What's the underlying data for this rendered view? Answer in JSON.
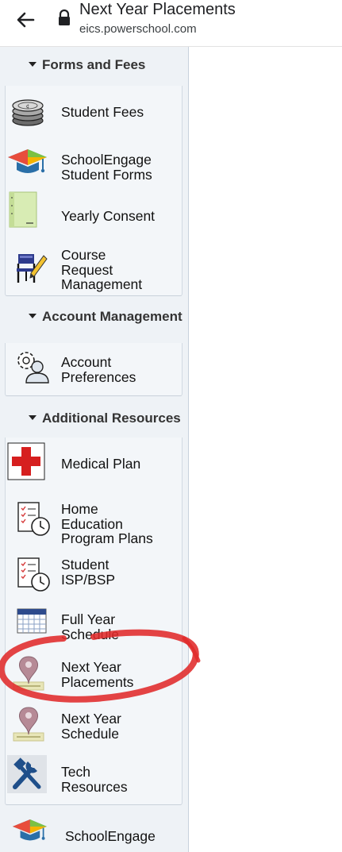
{
  "browser": {
    "title": "Next Year Placements",
    "url": "eics.powerschool.com",
    "back_icon": "back-arrow-icon",
    "lock_icon": "lock-icon"
  },
  "sidebar": {
    "sections": [
      {
        "header": "Forms and Fees",
        "items": [
          {
            "label": "Student Fees",
            "icon": "coins-icon"
          },
          {
            "label": "SchoolEngage\nStudent Forms",
            "icon": "graduation-cap-icon"
          },
          {
            "label": "Yearly Consent",
            "icon": "document-icon"
          },
          {
            "label": "Course\nRequest\nManagement",
            "icon": "chair-pencil-icon"
          }
        ]
      },
      {
        "header": "Account Management",
        "items": [
          {
            "label": "Account\nPreferences",
            "icon": "user-gear-icon"
          }
        ]
      },
      {
        "header": "Additional Resources",
        "items": [
          {
            "label": "Medical Plan",
            "icon": "medical-cross-icon"
          },
          {
            "label": "Home\nEducation\nProgram Plans",
            "icon": "checklist-clock-icon"
          },
          {
            "label": "Student\nISP/BSP",
            "icon": "checklist-clock-icon"
          },
          {
            "label": "Full Year\nSchedule",
            "icon": "calendar-icon"
          },
          {
            "label": "Next Year\nPlacements",
            "icon": "map-pin-icon"
          },
          {
            "label": "Next Year\nSchedule",
            "icon": "map-pin-icon"
          },
          {
            "label": "Tech\nResources",
            "icon": "tools-icon"
          }
        ]
      }
    ],
    "footer_item": {
      "label": "SchoolEngage",
      "icon": "graduation-cap-icon"
    }
  },
  "annotation": {
    "color": "#e02a2a",
    "target": "Next Year Placements"
  }
}
